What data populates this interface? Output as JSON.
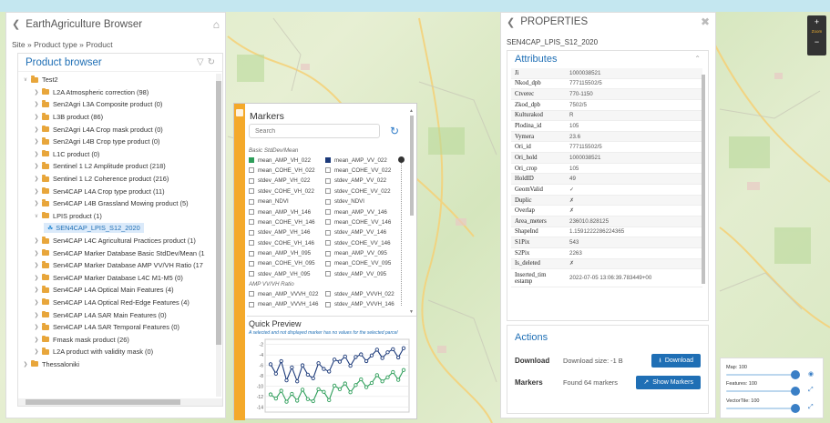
{
  "app": {
    "title": "EarthAgriculture Browser"
  },
  "breadcrumb": "Site » Product type » Product",
  "product_browser": {
    "title": "Product browser",
    "tree": [
      {
        "label": "Test2",
        "level": 0,
        "expanded": true
      },
      {
        "label": "L2A Atmospheric correction (98)",
        "level": 1
      },
      {
        "label": "Sen2Agri L3A Composite product (0)",
        "level": 1
      },
      {
        "label": "L3B product (86)",
        "level": 1
      },
      {
        "label": "Sen2Agri L4A Crop mask product (0)",
        "level": 1
      },
      {
        "label": "Sen2Agri L4B Crop type product (0)",
        "level": 1
      },
      {
        "label": "L1C product (0)",
        "level": 1
      },
      {
        "label": "Sentinel 1 L2 Amplitude product (218)",
        "level": 1
      },
      {
        "label": "Sentinel 1 L2 Coherence product (216)",
        "level": 1
      },
      {
        "label": "Sen4CAP L4A Crop type product (11)",
        "level": 1
      },
      {
        "label": "Sen4CAP L4B Grassland Mowing product (5)",
        "level": 1
      },
      {
        "label": "LPIS product (1)",
        "level": 1,
        "expanded": true
      },
      {
        "label": "SEN4CAP_LPIS_S12_2020",
        "level": 2,
        "leaf": true,
        "selected": true
      },
      {
        "label": "Sen4CAP L4C Agricultural Practices product (1)",
        "level": 1
      },
      {
        "label": "Sen4CAP Marker Database Basic StdDev/Mean (1",
        "level": 1
      },
      {
        "label": "Sen4CAP Marker Database AMP VV/VH Ratio (17",
        "level": 1
      },
      {
        "label": "Sen4CAP Marker Database L4C M1-M5 (0)",
        "level": 1
      },
      {
        "label": "Sen4CAP L4A Optical Main Features (4)",
        "level": 1
      },
      {
        "label": "Sen4CAP L4A Optical Red-Edge Features (4)",
        "level": 1
      },
      {
        "label": "Sen4CAP L4A SAR Main Features (0)",
        "level": 1
      },
      {
        "label": "Sen4CAP L4A SAR Temporal Features (0)",
        "level": 1
      },
      {
        "label": "Fmask mask product (26)",
        "level": 1
      },
      {
        "label": "L2A product with validity mask (0)",
        "level": 1
      },
      {
        "label": "Thessaloniki",
        "level": 0
      }
    ]
  },
  "markers": {
    "title": "Markers",
    "search_placeholder": "Search",
    "group1": "Basic StdDev/Mean",
    "group1_items": [
      [
        "mean_AMP_VH_022",
        "green"
      ],
      [
        "mean_AMP_VV_022",
        "blue"
      ],
      [
        "mean_COHE_VH_022",
        ""
      ],
      [
        "mean_COHE_VV_022",
        ""
      ],
      [
        "stdev_AMP_VH_022",
        ""
      ],
      [
        "stdev_AMP_VV_022",
        ""
      ],
      [
        "stdev_COHE_VH_022",
        ""
      ],
      [
        "stdev_COHE_VV_022",
        ""
      ],
      [
        "mean_NDVI",
        ""
      ],
      [
        "stdev_NDVI",
        ""
      ],
      [
        "mean_AMP_VH_146",
        ""
      ],
      [
        "mean_AMP_VV_146",
        ""
      ],
      [
        "mean_COHE_VH_146",
        ""
      ],
      [
        "mean_COHE_VV_146",
        ""
      ],
      [
        "stdev_AMP_VH_146",
        ""
      ],
      [
        "stdev_AMP_VV_146",
        ""
      ],
      [
        "stdev_COHE_VH_146",
        ""
      ],
      [
        "stdev_COHE_VV_146",
        ""
      ],
      [
        "mean_AMP_VH_095",
        ""
      ],
      [
        "mean_AMP_VV_095",
        ""
      ],
      [
        "mean_COHE_VH_095",
        ""
      ],
      [
        "mean_COHE_VV_095",
        ""
      ],
      [
        "stdev_AMP_VH_095",
        ""
      ],
      [
        "stdev_AMP_VV_095",
        ""
      ]
    ],
    "group2": "AMP VV/VH Ratio",
    "group2_items": [
      [
        "mean_AMP_VVVH_022",
        ""
      ],
      [
        "stdev_AMP_VVVH_022",
        ""
      ],
      [
        "mean_AMP_VVVH_146",
        ""
      ],
      [
        "stdev_AMP_VVVH_146",
        ""
      ]
    ]
  },
  "quick_preview": {
    "title": "Quick Preview",
    "note": "A selected and not displayed marker has no values for the selected parcel",
    "chart_data": {
      "type": "line",
      "yticks": [
        -2,
        -4,
        -6,
        -8,
        -10,
        -12,
        -14
      ],
      "ylim": [
        -15,
        -1
      ],
      "series": [
        {
          "color": "#1c3a7a",
          "values": [
            -5.8,
            -7.6,
            -5.2,
            -8.9,
            -6.4,
            -9.1,
            -6.0,
            -7.8,
            -8.5,
            -5.6,
            -6.7,
            -7.2,
            -4.9,
            -5.3,
            -4.3,
            -6.1,
            -4.4,
            -3.9,
            -5.2,
            -4.1,
            -3.0,
            -4.6,
            -3.5,
            -2.9,
            -4.5,
            -2.7
          ]
        },
        {
          "color": "#2e9e5a",
          "values": [
            -11.6,
            -12.4,
            -10.9,
            -13.0,
            -11.5,
            -12.8,
            -10.7,
            -12.5,
            -12.9,
            -10.6,
            -11.1,
            -12.7,
            -9.9,
            -10.6,
            -9.5,
            -11.2,
            -9.8,
            -8.7,
            -10.2,
            -9.4,
            -7.9,
            -9.1,
            -8.3,
            -7.3,
            -8.8,
            -6.9
          ]
        }
      ]
    }
  },
  "properties": {
    "title": "PROPERTIES",
    "product": "SEN4CAP_LPIS_S12_2020",
    "attributes_title": "Attributes",
    "attributes": [
      [
        "Ji",
        "1000038521"
      ],
      [
        "Nkod_dpb",
        "777115502/5"
      ],
      [
        "Ctverec",
        "770-1150"
      ],
      [
        "Zkod_dpb",
        "7502/5"
      ],
      [
        "Kulturakod",
        "R"
      ],
      [
        "Plodina_id",
        "105"
      ],
      [
        "Vymera",
        "23.6"
      ],
      [
        "Ori_id",
        "777115502/5"
      ],
      [
        "Ori_hold",
        "1000038521"
      ],
      [
        "Ori_crop",
        "105"
      ],
      [
        "HoldID",
        "49"
      ],
      [
        "GeomValid",
        "✓"
      ],
      [
        "Duplic",
        "✗"
      ],
      [
        "Overlap",
        "✗"
      ],
      [
        "Area_meters",
        "236010.828125"
      ],
      [
        "ShapeInd",
        "1.15912222862243​65"
      ],
      [
        "S1Pix",
        "543"
      ],
      [
        "S2Pix",
        "2263"
      ],
      [
        "Is_deleted",
        "✗"
      ],
      [
        "Inserted_timestamp",
        "2022-07-05 13:06:39.783449+00"
      ]
    ],
    "actions_title": "Actions",
    "download_label": "Download",
    "download_size": "Download size: -1 B",
    "download_button": "Download",
    "markers_label": "Markers",
    "markers_found": "Found 64 markers",
    "show_markers_button": "Show Markers"
  },
  "zoom": {
    "plus": "+",
    "label": "Zoom",
    "minus": "−"
  },
  "layers": [
    {
      "label": "Map: 100",
      "value": 100
    },
    {
      "label": "Features: 100",
      "value": 100
    },
    {
      "label": "VectorTile: 100",
      "value": 100
    }
  ]
}
